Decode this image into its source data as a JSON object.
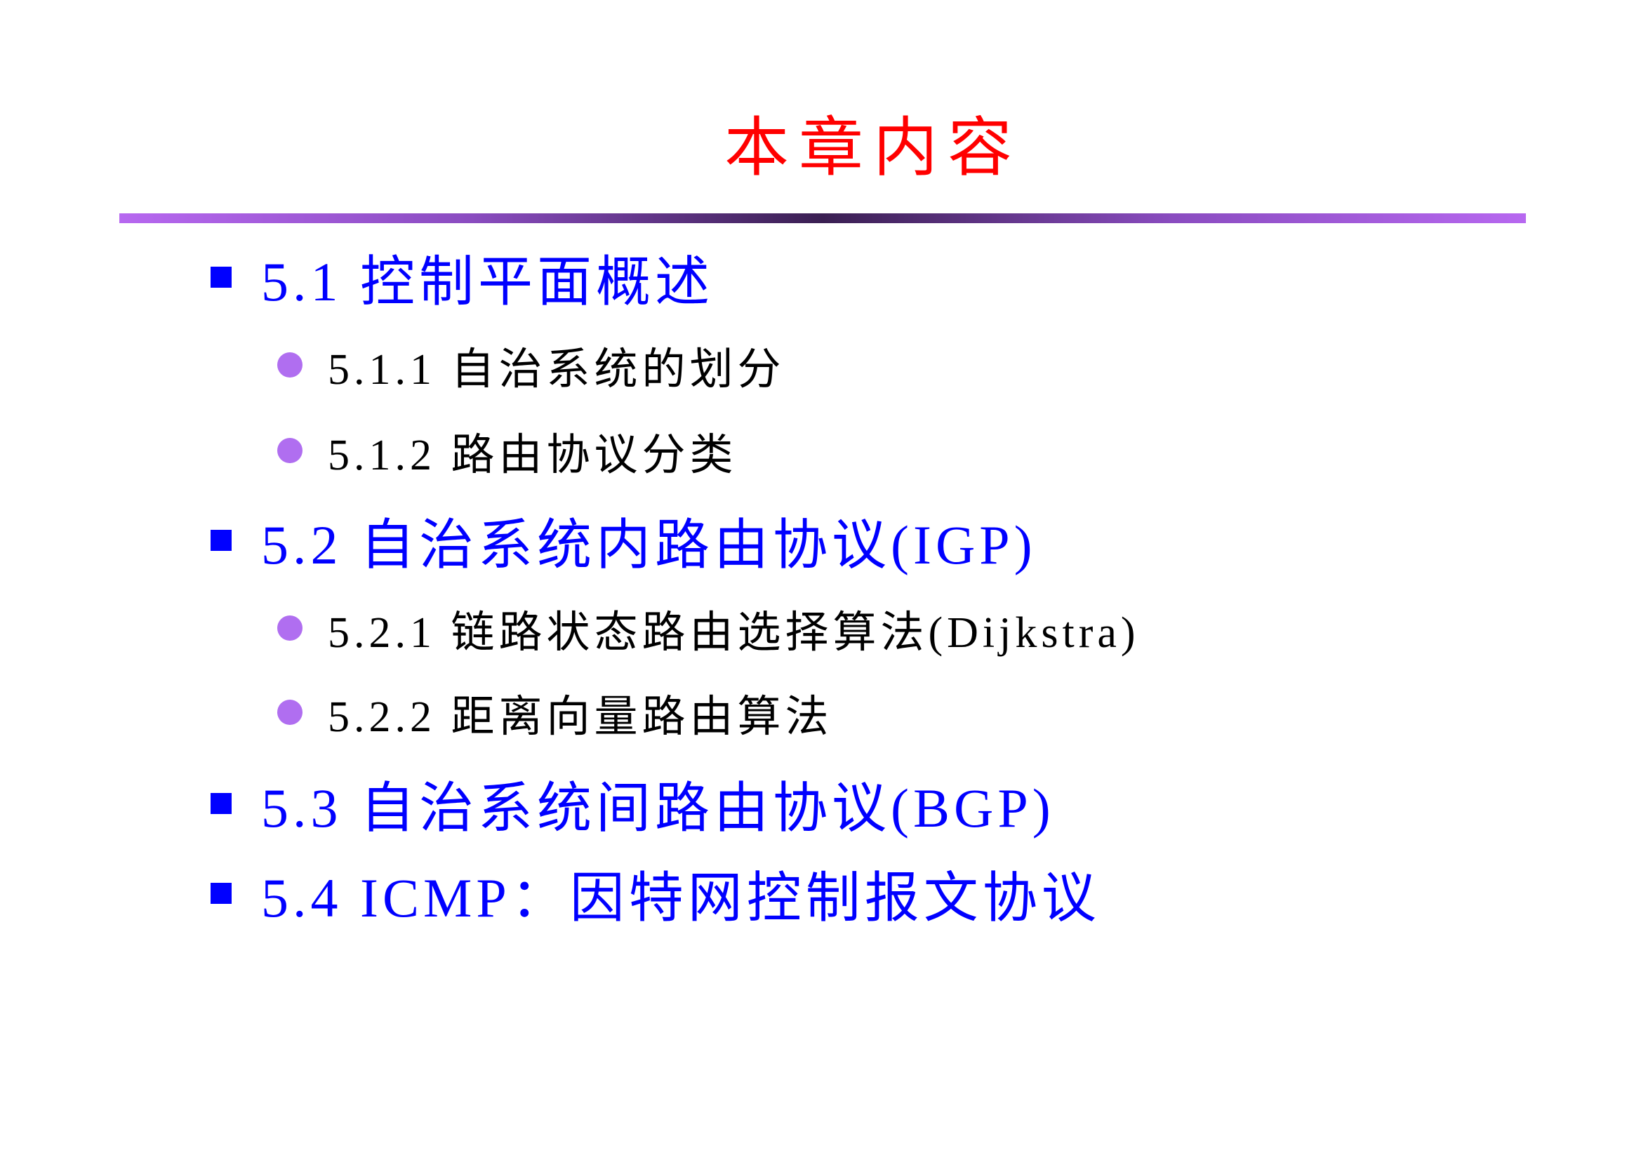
{
  "title": "本章内容",
  "colors": {
    "title": "#ff0000",
    "level1_text": "#0000ff",
    "level1_bullet": "#0000ff",
    "level2_text": "#000000",
    "level2_bullet": "#b06ef0",
    "divider": "#b768f0"
  },
  "outline": [
    {
      "level": 1,
      "text": "5.1 控制平面概述"
    },
    {
      "level": 2,
      "text": "5.1.1 自治系统的划分"
    },
    {
      "level": 2,
      "text": "5.1.2 路由协议分类"
    },
    {
      "level": 1,
      "text": "5.2 自治系统内路由协议(IGP)"
    },
    {
      "level": 2,
      "text": "5.2.1 链路状态路由选择算法(Dijkstra)"
    },
    {
      "level": 2,
      "text": "5.2.2 距离向量路由算法"
    },
    {
      "level": 1,
      "text": "5.3 自治系统间路由协议(BGP)"
    },
    {
      "level": 1,
      "text": "5.4 ICMP：因特网控制报文协议"
    }
  ]
}
